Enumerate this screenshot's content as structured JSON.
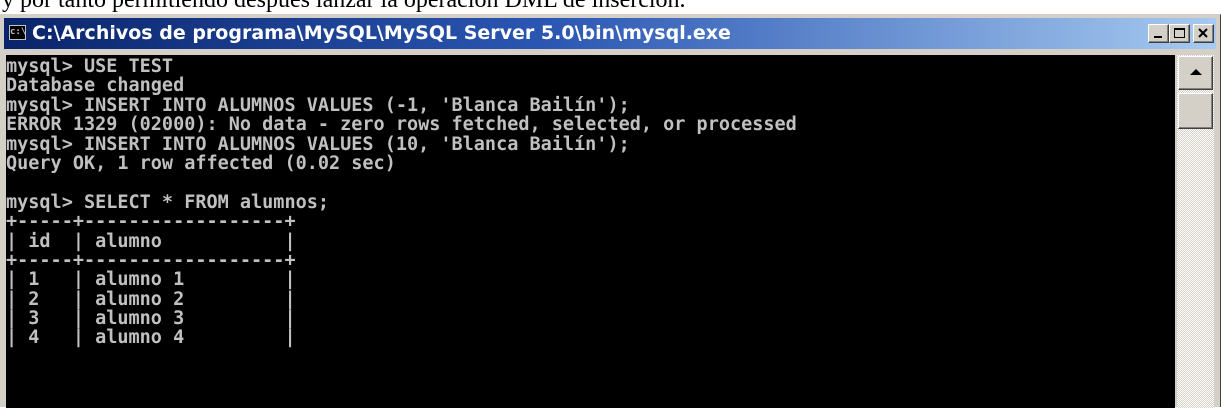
{
  "page": {
    "fragment_text": "y por tanto permitiendo después lanzar la operación DML de inserción."
  },
  "window": {
    "title": "C:\\Archivos de programa\\MySQL\\MySQL Server 5.0\\bin\\mysql.exe",
    "icon_label": "c:\\",
    "icon": "console-app-icon",
    "buttons": [
      "minimize-icon",
      "maximize-icon",
      "close-icon"
    ]
  },
  "colors": {
    "console_bg": "#000000",
    "console_text": "#c0c0c0",
    "titlebar_start": "#0a246a",
    "titlebar_end": "#a6caf0"
  },
  "console": {
    "lines": [
      "mysql> USE TEST",
      "Database changed",
      "mysql> INSERT INTO ALUMNOS VALUES (-1, 'Blanca Bailín');",
      "ERROR 1329 (02000): No data - zero rows fetched, selected, or processed",
      "mysql> INSERT INTO ALUMNOS VALUES (10, 'Blanca Bailín');",
      "Query OK, 1 row affected (0.02 sec)",
      "",
      "mysql> SELECT * FROM alumnos;",
      "+-----+------------------+",
      "| id  | alumno           |",
      "+-----+------------------+",
      "| 1   | alumno 1         |",
      "| 2   | alumno 2         |",
      "| 3   | alumno 3         |",
      "| 4   | alumno 4         |"
    ]
  }
}
